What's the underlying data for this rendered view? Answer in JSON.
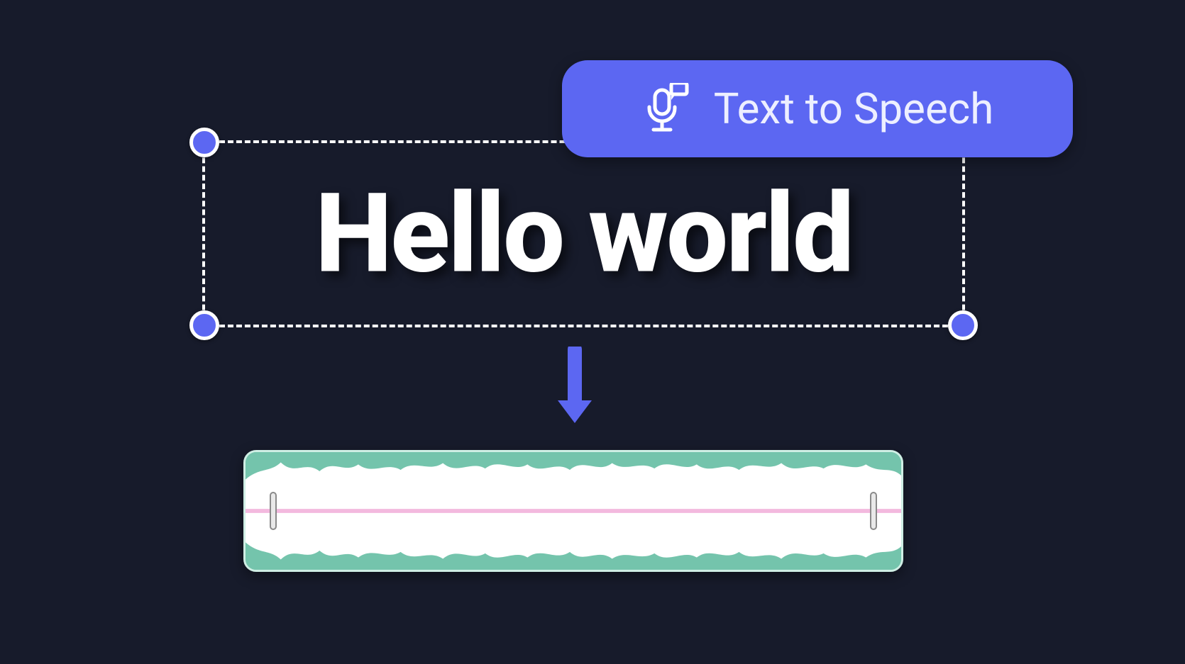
{
  "canvas": {
    "selected_text": "Hello world"
  },
  "tts_button": {
    "label": "Text to Speech"
  },
  "colors": {
    "bg": "#171B2B",
    "accent": "#5C67F2",
    "handle_fill": "#5C67F2",
    "handle_ring": "#ffffff",
    "wave_bg": "#74C4AC",
    "wave_fg": "#ffffff",
    "wave_line": "#F3B9DE"
  }
}
